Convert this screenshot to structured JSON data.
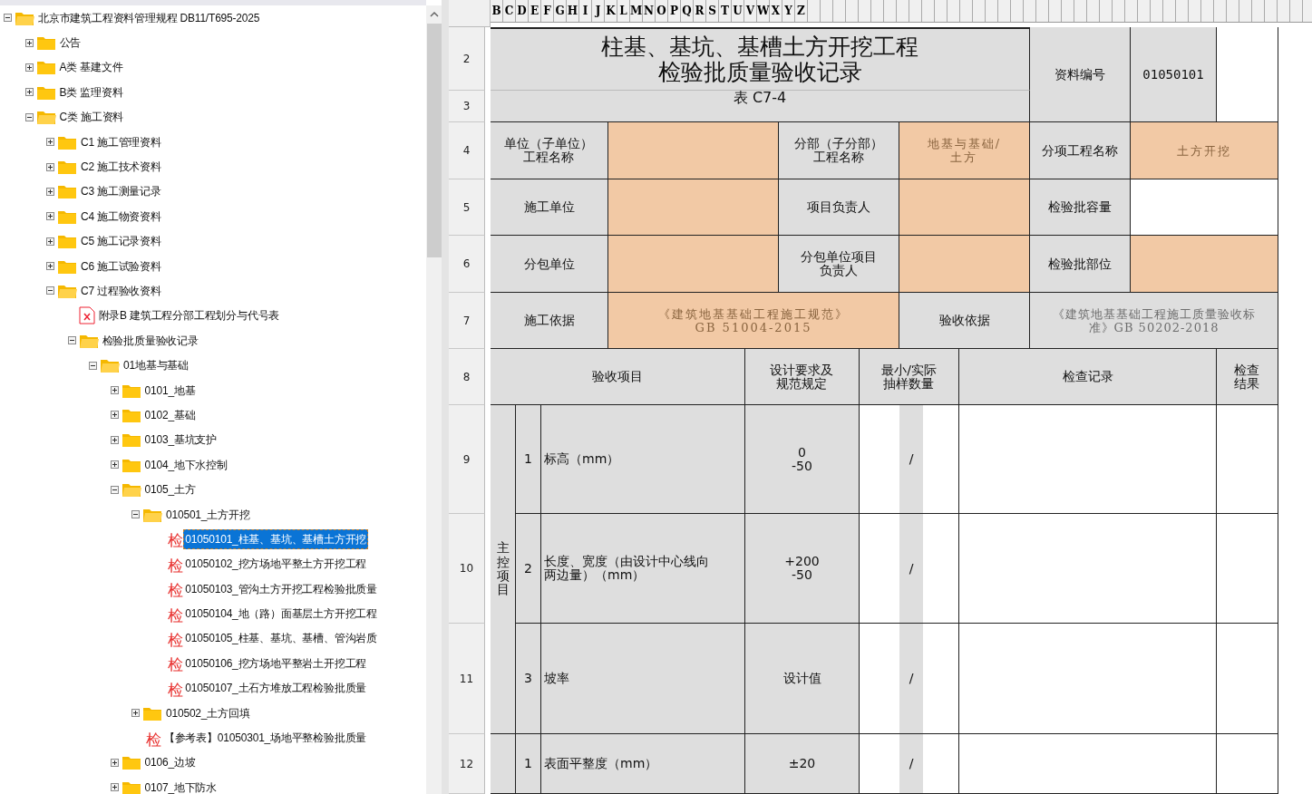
{
  "tree": [
    {
      "kind": "folder",
      "label": "北京市建筑工程资料管理规程 DB11/T695-2025",
      "expanded": true,
      "selected": false,
      "children": [
        {
          "kind": "folder",
          "label": "公告",
          "expanded": false,
          "selected": false
        },
        {
          "kind": "folder",
          "label": "A类 基建文件",
          "expanded": false,
          "selected": false
        },
        {
          "kind": "folder",
          "label": "B类 监理资料",
          "expanded": false,
          "selected": false
        },
        {
          "kind": "folder",
          "label": "C类 施工资料",
          "expanded": true,
          "selected": false,
          "children": [
            {
              "kind": "folder",
              "label": "C1 施工管理资料",
              "expanded": false,
              "selected": false
            },
            {
              "kind": "folder",
              "label": "C2 施工技术资料",
              "expanded": false,
              "selected": false
            },
            {
              "kind": "folder",
              "label": "C3 施工测量记录",
              "expanded": false,
              "selected": false
            },
            {
              "kind": "folder",
              "label": "C4 施工物资资料",
              "expanded": false,
              "selected": false
            },
            {
              "kind": "folder",
              "label": "C5 施工记录资料",
              "expanded": false,
              "selected": false
            },
            {
              "kind": "folder",
              "label": "C6 施工试验资料",
              "expanded": false,
              "selected": false
            },
            {
              "kind": "folder",
              "label": "C7 过程验收资料",
              "expanded": true,
              "selected": false,
              "children": [
                {
                  "kind": "doc",
                  "label": "附录B 建筑工程分部工程划分与代号表",
                  "selected": false
                },
                {
                  "kind": "folder",
                  "label": "检验批质量验收记录",
                  "expanded": true,
                  "selected": false,
                  "children": [
                    {
                      "kind": "folder",
                      "label": "01地基与基础",
                      "expanded": true,
                      "selected": false,
                      "children": [
                        {
                          "kind": "folder",
                          "label": "0101_地基",
                          "expanded": false,
                          "selected": false
                        },
                        {
                          "kind": "folder",
                          "label": "0102_基础",
                          "expanded": false,
                          "selected": false
                        },
                        {
                          "kind": "folder",
                          "label": "0103_基坑支护",
                          "expanded": false,
                          "selected": false
                        },
                        {
                          "kind": "folder",
                          "label": "0104_地下水控制",
                          "expanded": false,
                          "selected": false
                        },
                        {
                          "kind": "folder",
                          "label": "0105_土方",
                          "expanded": true,
                          "selected": false,
                          "children": [
                            {
                              "kind": "folder",
                              "label": "010501_土方开挖",
                              "expanded": true,
                              "selected": false,
                              "children": [
                                {
                                  "kind": "check",
                                  "mark": "检",
                                  "label": "01050101_柱基、基坑、基槽土方开挖",
                                  "selected": true
                                },
                                {
                                  "kind": "check",
                                  "mark": "检",
                                  "label": "01050102_挖方场地平整土方开挖工程",
                                  "selected": false
                                },
                                {
                                  "kind": "check",
                                  "mark": "检",
                                  "label": "01050103_管沟土方开挖工程检验批质量",
                                  "selected": false
                                },
                                {
                                  "kind": "check",
                                  "mark": "检",
                                  "label": "01050104_地（路）面基层土方开挖工程",
                                  "selected": false
                                },
                                {
                                  "kind": "check",
                                  "mark": "检",
                                  "label": "01050105_柱基、基坑、基槽、管沟岩质",
                                  "selected": false
                                },
                                {
                                  "kind": "check",
                                  "mark": "检",
                                  "label": "01050106_挖方场地平整岩土开挖工程",
                                  "selected": false
                                },
                                {
                                  "kind": "check",
                                  "mark": "检",
                                  "label": "01050107_土石方堆放工程检验批质量",
                                  "selected": false
                                }
                              ]
                            },
                            {
                              "kind": "folder",
                              "label": "010502_土方回填",
                              "expanded": false,
                              "selected": false
                            },
                            {
                              "kind": "check",
                              "mark": "检",
                              "label": "【参考表】01050301_场地平整检验批质量",
                              "selected": false
                            }
                          ]
                        },
                        {
                          "kind": "folder",
                          "label": "0106_边坡",
                          "expanded": false,
                          "selected": false
                        },
                        {
                          "kind": "folder",
                          "label": "0107_地下防水",
                          "expanded": false,
                          "selected": false
                        }
                      ]
                    }
                  ]
                }
              ]
            }
          ]
        }
      ]
    }
  ],
  "sheet": {
    "column_letters": [
      "B",
      "C",
      "D",
      "E",
      "F",
      "G",
      "H",
      "I",
      "J",
      "K",
      "L",
      "M",
      "N",
      "O",
      "P",
      "Q",
      "R",
      "S",
      "T",
      "U",
      "V",
      "W",
      "X",
      "Y",
      "Z"
    ],
    "row_numbers": [
      "2",
      "3",
      "4",
      "5",
      "6",
      "7",
      "8",
      "9",
      "10",
      "11",
      "12"
    ],
    "title": "柱基、基坑、基槽土方开挖工程检验批质量验收记录",
    "table_no": "表 C7-4",
    "doc_no_label": "资料编号",
    "doc_no": "01050101",
    "info_rows": [
      [
        {
          "kind": "label",
          "text": "单位（子单位）工程名称"
        },
        {
          "kind": "input"
        },
        {
          "kind": "label",
          "text": "分部（子分部）工程名称"
        },
        {
          "kind": "input",
          "text": "地基与基础/\n土方"
        },
        {
          "kind": "label",
          "text": "分项工程名称"
        },
        {
          "kind": "input",
          "text": "土方开挖"
        }
      ],
      [
        {
          "kind": "label",
          "text": "施工单位"
        },
        {
          "kind": "input"
        },
        {
          "kind": "label",
          "text": "项目负责人"
        },
        {
          "kind": "input"
        },
        {
          "kind": "label",
          "text": "检验批容量"
        },
        {
          "kind": "blank"
        }
      ],
      [
        {
          "kind": "label",
          "text": "分包单位"
        },
        {
          "kind": "input"
        },
        {
          "kind": "label",
          "text": "分包单位项目负责人"
        },
        {
          "kind": "input"
        },
        {
          "kind": "label",
          "text": "检验批部位"
        },
        {
          "kind": "input"
        }
      ],
      [
        {
          "kind": "label",
          "text": "施工依据"
        },
        {
          "kind": "input",
          "text": "《建筑地基基础工程施工规范》\nGB 51004-2015"
        },
        {
          "kind": "label",
          "text": "验收依据"
        },
        {
          "kind": "note",
          "text": "《建筑地基基础工程施工质量验收标准》GB 50202-2018"
        }
      ]
    ],
    "columns": [
      "验收项目",
      "设计要求及规范规定",
      "最小/实际抽样数量",
      "检查记录",
      "检查结果"
    ],
    "groups": [
      {
        "label": "主控项目",
        "items": [
          {
            "no": "1",
            "name": "标高（mm）",
            "design": "0\n-50",
            "sample": "/"
          },
          {
            "no": "2",
            "name": "长度、宽度（由设计中心线向两边量）（mm）",
            "design": "+200\n-50",
            "sample": "/"
          },
          {
            "no": "3",
            "name": "坡率",
            "design": "设计值",
            "sample": "/"
          }
        ]
      },
      {
        "items": [
          {
            "no": "1",
            "name": "表面平整度（mm）",
            "design": "±20",
            "sample": "/"
          }
        ]
      }
    ]
  }
}
